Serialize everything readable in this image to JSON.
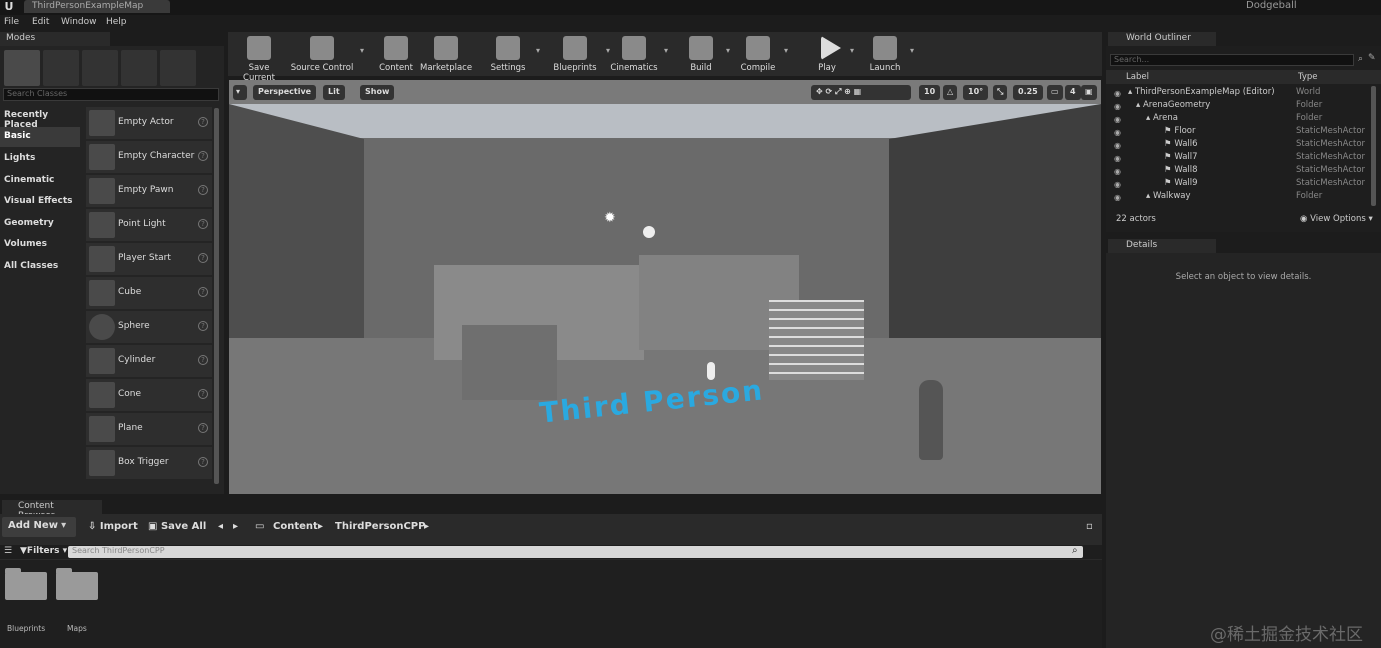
{
  "titlebar": {
    "map_tab": "ThirdPersonExampleMap",
    "project": "Dodgeball",
    "logo_glyph": "U"
  },
  "menu": [
    "File",
    "Edit",
    "Window",
    "Help"
  ],
  "modes": {
    "tab": "Modes",
    "search_placeholder": "Search Classes",
    "categories": [
      "Recently Placed",
      "Basic",
      "Lights",
      "Cinematic",
      "Visual Effects",
      "Geometry",
      "Volumes",
      "All Classes"
    ],
    "active_category": "Basic",
    "items": [
      "Empty Actor",
      "Empty Character",
      "Empty Pawn",
      "Point Light",
      "Player Start",
      "Cube",
      "Sphere",
      "Cylinder",
      "Cone",
      "Plane",
      "Box Trigger"
    ]
  },
  "toolbar": {
    "buttons": [
      "Save Current",
      "Source Control",
      "Content",
      "Marketplace",
      "Settings",
      "Blueprints",
      "Cinematics",
      "Build",
      "Compile",
      "Play",
      "Launch"
    ]
  },
  "viewport": {
    "perspective": "Perspective",
    "lit": "Lit",
    "show": "Show",
    "grid_snap": "10",
    "rotation_snap": "10°",
    "scale_snap": "0.25",
    "camera_speed": "4",
    "floor_text": "Third Person"
  },
  "world_outliner": {
    "tab": "World Outliner",
    "search_placeholder": "Search...",
    "col_label": "Label",
    "col_type": "Type",
    "rows": [
      {
        "label": "ThirdPersonExampleMap (Editor)",
        "type": "World"
      },
      {
        "label": "ArenaGeometry",
        "type": "Folder"
      },
      {
        "label": "Arena",
        "type": "Folder"
      },
      {
        "label": "Floor",
        "type": "StaticMeshActor"
      },
      {
        "label": "Wall6",
        "type": "StaticMeshActor"
      },
      {
        "label": "Wall7",
        "type": "StaticMeshActor"
      },
      {
        "label": "Wall8",
        "type": "StaticMeshActor"
      },
      {
        "label": "Wall9",
        "type": "StaticMeshActor"
      },
      {
        "label": "Walkway",
        "type": "Folder"
      }
    ],
    "actor_count": "22 actors",
    "view_options": "View Options"
  },
  "details": {
    "tab": "Details",
    "message": "Select an object to view details."
  },
  "content_browser": {
    "tab": "Content Browser",
    "add_new": "Add New",
    "import": "Import",
    "save_all": "Save All",
    "path": [
      "Content",
      "ThirdPersonCPP"
    ],
    "filters": "Filters",
    "search_placeholder": "Search ThirdPersonCPP",
    "folders": [
      "Blueprints",
      "Maps"
    ]
  },
  "watermark": "@稀土掘金技术社区"
}
